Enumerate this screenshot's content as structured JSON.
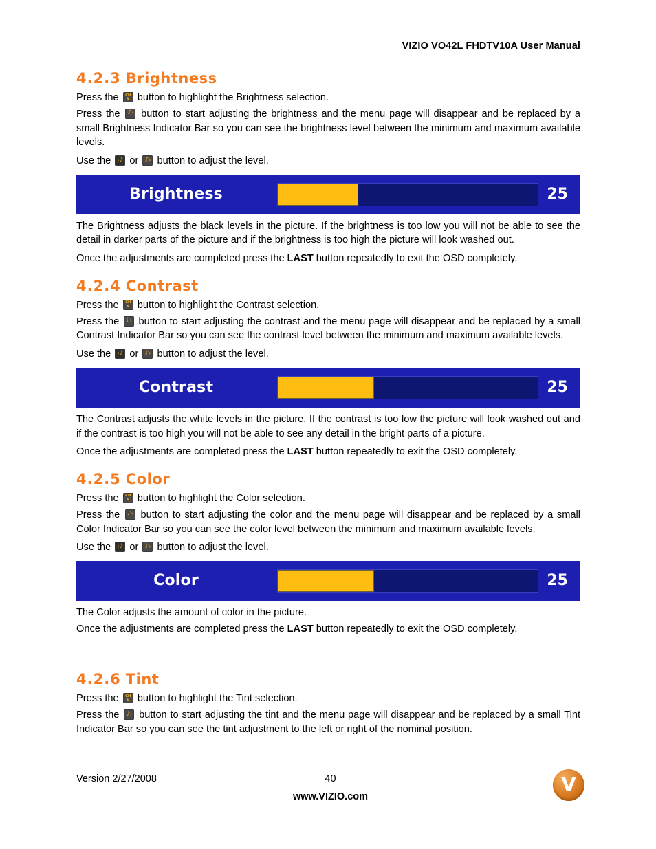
{
  "header": {
    "title": "VIZIO VO42L FHDTV10A User Manual"
  },
  "icons": {
    "channel_down": {
      "name": "ch-down-button-icon",
      "top": "CH",
      "bottom": "∨"
    },
    "volume_right": {
      "name": "volume-right-button-icon",
      "speaker": "♪",
      "arrow": "›"
    },
    "volume_left": {
      "name": "volume-left-button-icon",
      "speaker": "♪",
      "arrow": "‹"
    }
  },
  "sections": [
    {
      "id": "brightness",
      "number": "4.2.3",
      "name": "Brightness",
      "press_highlight_pre": "Press the ",
      "press_highlight_post": " button to highlight the Brightness selection.",
      "press_adjust_pre": "Press the ",
      "press_adjust_post": " button to start adjusting the brightness and the menu page will disappear and be replaced by a small Brightness Indicator Bar so you can see the brightness level between the minimum and maximum available levels.",
      "use_pre": "Use the ",
      "use_mid": " or ",
      "use_post": " button to adjust the level.",
      "osd": {
        "label": "Brightness",
        "value": "25",
        "fill_percent": 31
      },
      "explain": "The Brightness adjusts the black levels in the picture.  If the brightness is too low you will not be able to see the detail in darker parts of the picture and if the brightness is too high the picture will look washed out.",
      "last_pre": "Once the adjustments are completed press the ",
      "last_key": "LAST",
      "last_post": " button repeatedly to exit the OSD completely."
    },
    {
      "id": "contrast",
      "number": "4.2.4",
      "name": "Contrast",
      "press_highlight_pre": "Press the ",
      "press_highlight_post": " button to highlight the Contrast selection.",
      "press_adjust_pre": "Press the ",
      "press_adjust_post": " button to start adjusting the contrast and the menu page will disappear and be replaced by a small Contrast Indicator Bar so you can see the contrast level between the minimum and maximum available levels.",
      "use_pre": "Use the ",
      "use_mid": " or ",
      "use_post": " button to adjust the level.",
      "osd": {
        "label": "Contrast",
        "value": "25",
        "fill_percent": 37
      },
      "explain": "The Contrast adjusts the white levels in the picture.  If the contrast is too low the picture will look washed out and if the contrast is too high you will not be able to see any detail in the bright parts of a picture.",
      "last_pre": "Once the adjustments are completed press the ",
      "last_key": "LAST",
      "last_post": " button repeatedly to exit the OSD completely."
    },
    {
      "id": "color",
      "number": "4.2.5",
      "name": "Color",
      "press_highlight_pre": "Press the ",
      "press_highlight_post": " button to highlight the Color selection.",
      "press_adjust_pre": "Press the ",
      "press_adjust_post": " button to start adjusting the color and the menu page will disappear and be replaced by a small Color Indicator Bar so you can see the color level between the minimum and maximum available levels.",
      "use_pre": "Use the ",
      "use_mid": " or ",
      "use_post": " button to adjust the level.",
      "osd": {
        "label": "Color",
        "value": "25",
        "fill_percent": 37
      },
      "explain": "The Color adjusts the amount of color in the picture.",
      "last_pre": "Once the adjustments are completed press the ",
      "last_key": "LAST",
      "last_post": " button repeatedly to exit the OSD completely."
    },
    {
      "id": "tint",
      "number": "4.2.6",
      "name": "Tint",
      "press_highlight_pre": "Press the ",
      "press_highlight_post": " button to highlight the Tint selection.",
      "press_adjust_pre": "Press the ",
      "press_adjust_post": " button to start adjusting the tint and the menu page will disappear and be replaced by a small Tint Indicator Bar so you can see the tint adjustment to the left or right of the nominal position."
    }
  ],
  "footer": {
    "version": "Version 2/27/2008",
    "page_number": "40",
    "website": "www.VIZIO.com",
    "logo_letter": "V"
  },
  "colors": {
    "heading_orange": "#F47A20",
    "osd_panel_blue": "#1C1FB0",
    "osd_track_blue": "#0D1670",
    "osd_fill_yellow": "#FFBC11",
    "logo_orange": "#DE8127"
  }
}
